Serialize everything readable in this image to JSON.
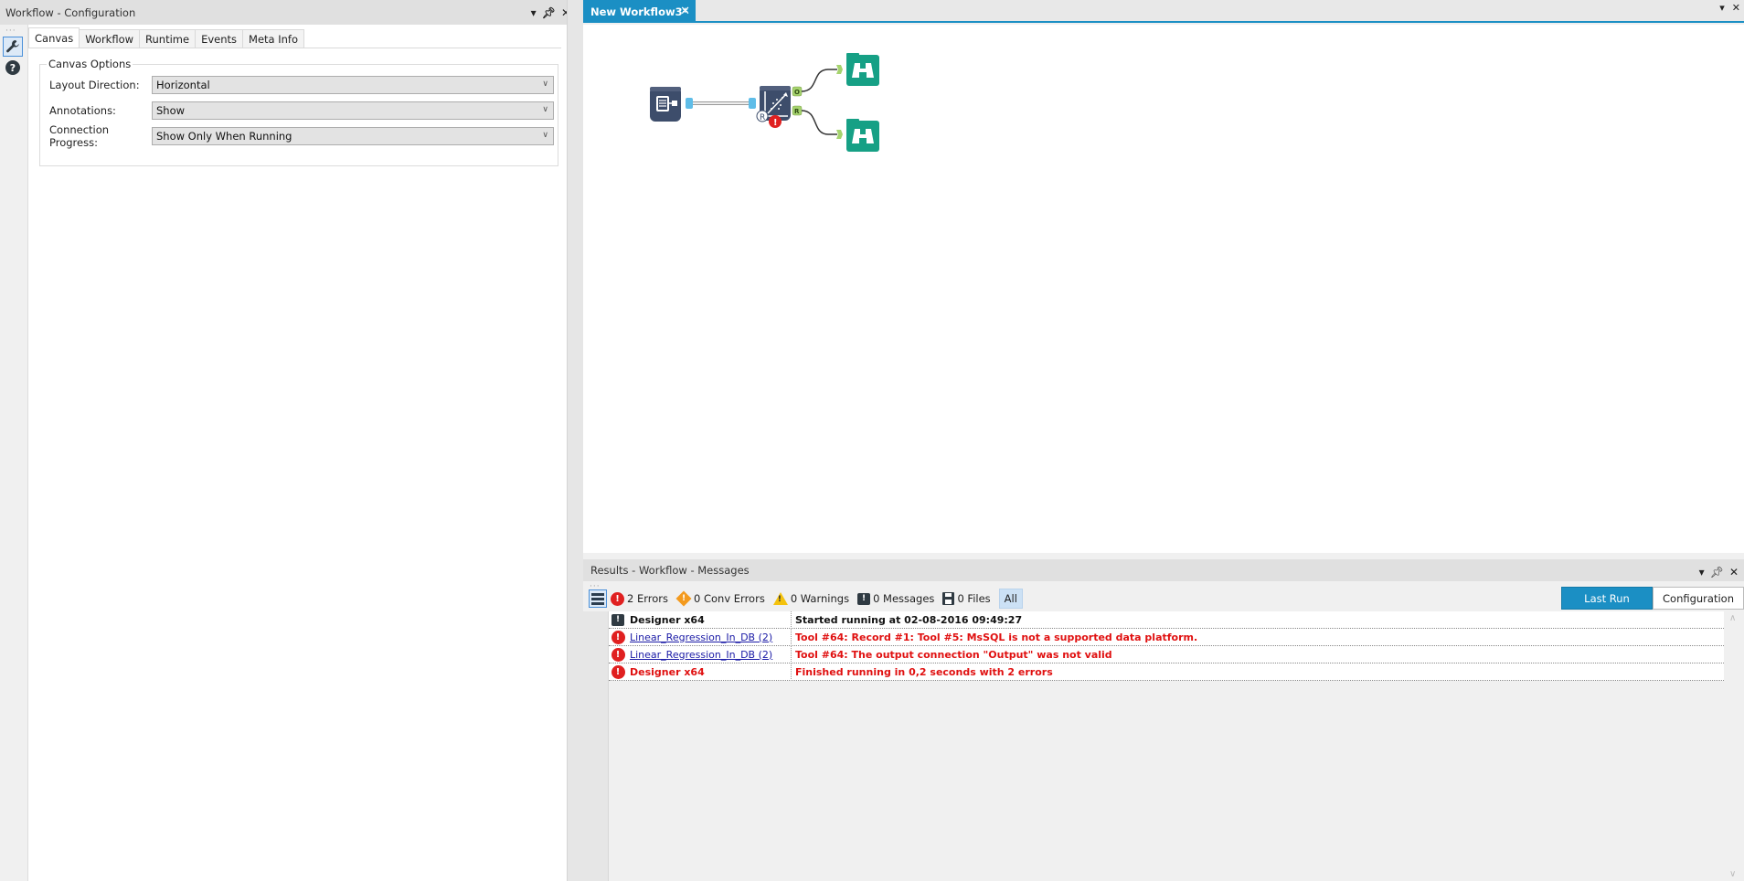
{
  "config_panel": {
    "title": "Workflow - Configuration",
    "controls": {
      "dropdown": "▾",
      "pin": "⊥",
      "close": "✕"
    },
    "side_icons": [
      "wrench-icon",
      "help-icon"
    ],
    "tabs": [
      {
        "label": "Canvas",
        "active": true
      },
      {
        "label": "Workflow",
        "active": false
      },
      {
        "label": "Runtime",
        "active": false
      },
      {
        "label": "Events",
        "active": false
      },
      {
        "label": "Meta Info",
        "active": false
      }
    ],
    "group_label": "Canvas Options",
    "fields": [
      {
        "label": "Layout Direction:",
        "value": "Horizontal"
      },
      {
        "label": "Annotations:",
        "value": "Show"
      },
      {
        "label": "Connection Progress:",
        "value": "Show Only When Running"
      }
    ]
  },
  "document": {
    "tab_label": "New Workflow3*",
    "tab_close": "✕",
    "tools": [
      {
        "name": "input-data-tool",
        "type": "input",
        "color": "#3d4d6b"
      },
      {
        "name": "linear-regression-in-db-tool",
        "type": "regression",
        "color": "#3d4d6b",
        "error": true,
        "anchors": [
          "O",
          "R"
        ]
      },
      {
        "name": "browse-tool-1",
        "type": "browse",
        "color": "#16a085"
      },
      {
        "name": "browse-tool-2",
        "type": "browse",
        "color": "#16a085"
      }
    ],
    "colors": {
      "accent": "#1b8fc4",
      "connector": "#5fbde8",
      "anchor": "#a6d36e",
      "error": "#e02020"
    }
  },
  "results": {
    "title": "Results - Workflow - Messages",
    "filters": {
      "errors": "2 Errors",
      "conv_errors": "0 Conv Errors",
      "warnings": "0 Warnings",
      "messages": "0 Messages",
      "files": "0 Files",
      "all": "All"
    },
    "buttons": {
      "last_run": "Last Run",
      "configuration": "Configuration"
    },
    "rows": [
      {
        "icon": "message-icon",
        "source": "Designer x64",
        "source_style": "bold",
        "message": "Started running  at 02-08-2016 09:49:27",
        "message_style": "black"
      },
      {
        "icon": "error-icon",
        "source": "Linear_Regression_In_DB (2)",
        "source_style": "link",
        "message": "Tool #64: Record #1: Tool #5: MsSQL is not a supported data platform.",
        "message_style": "red"
      },
      {
        "icon": "error-icon",
        "source": "Linear_Regression_In_DB (2)",
        "source_style": "link",
        "message": "Tool #64: The output connection \"Output\" was not valid",
        "message_style": "red"
      },
      {
        "icon": "error-icon",
        "source": "Designer x64",
        "source_style": "red",
        "message": "Finished running  in 0,2 seconds with 2 errors",
        "message_style": "red"
      }
    ]
  }
}
